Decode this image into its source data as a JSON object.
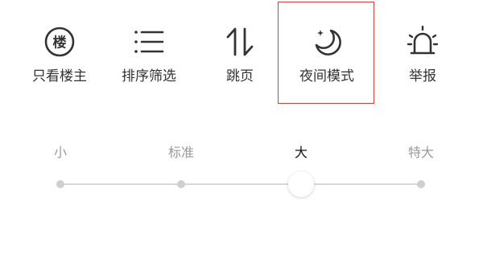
{
  "actions": [
    {
      "label": "只看楼主",
      "icon": "louzhu-badge-icon"
    },
    {
      "label": "排序筛选",
      "icon": "list-sort-icon"
    },
    {
      "label": "跳页",
      "icon": "up-down-arrows-icon"
    },
    {
      "label": "夜间模式",
      "icon": "moon-icon"
    },
    {
      "label": "举报",
      "icon": "alarm-siren-icon"
    }
  ],
  "louzhu_badge_char": "楼",
  "highlight_color": "#e53935",
  "font_size": {
    "options": [
      "小",
      "标准",
      "大",
      "特大"
    ],
    "selected": "大",
    "selected_index": 2
  }
}
